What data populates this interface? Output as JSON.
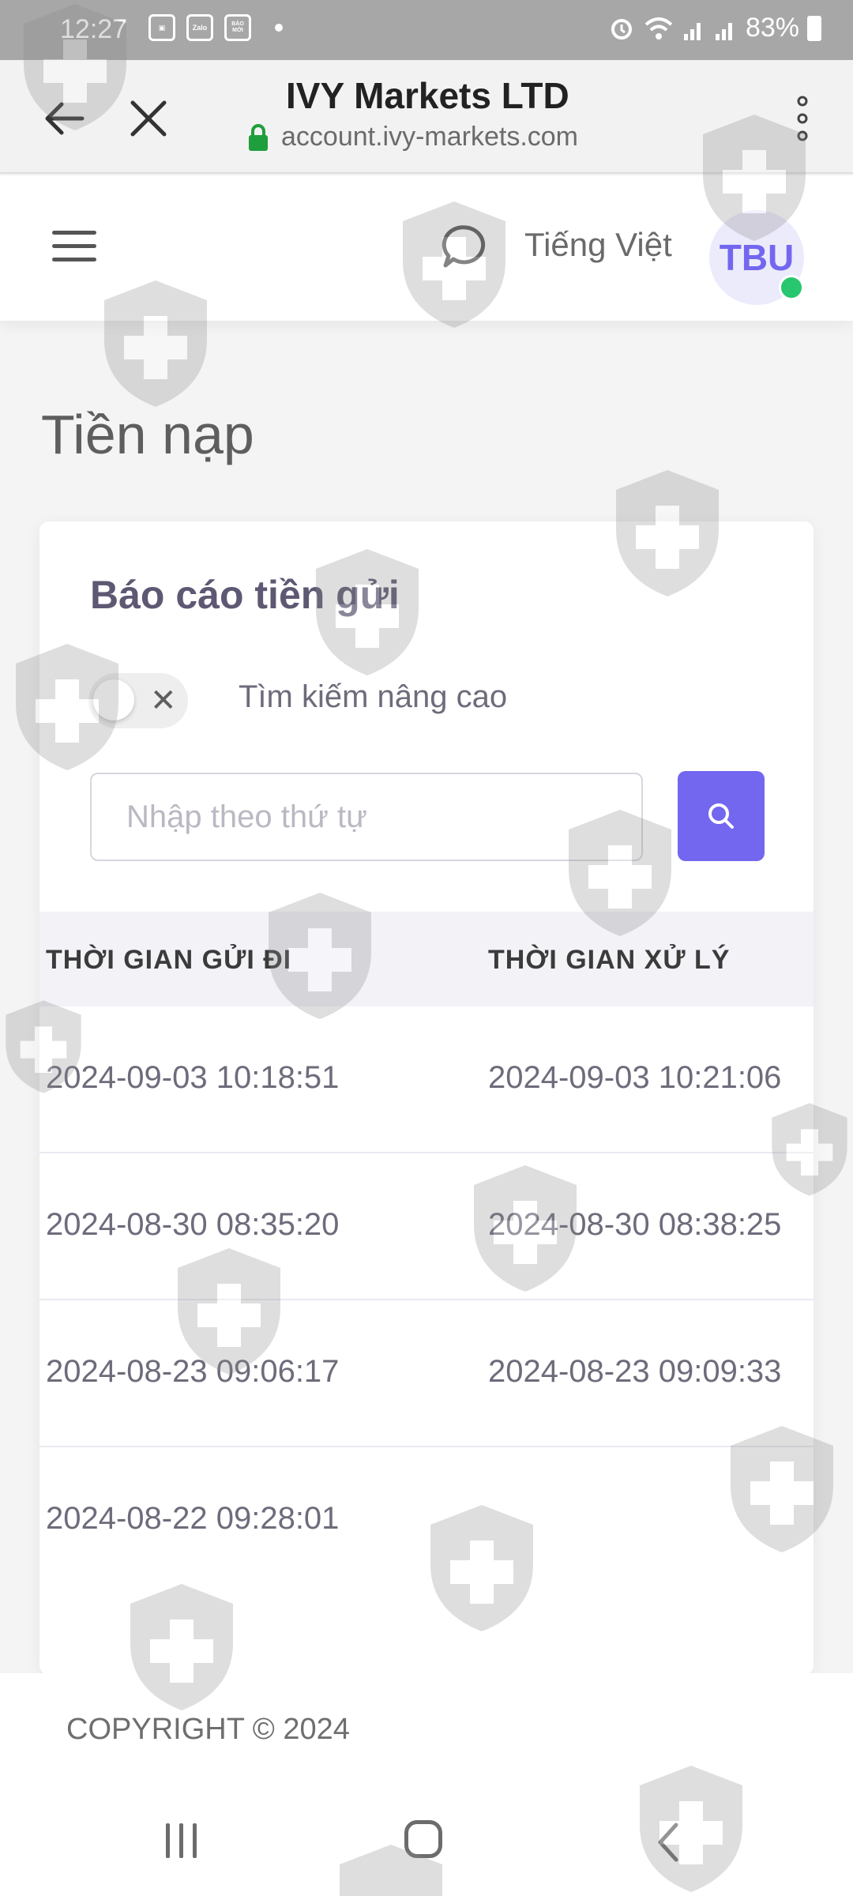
{
  "status_bar": {
    "time": "12:27",
    "notifications": [
      "Zalo",
      "BÁO MỚI"
    ],
    "battery": "83%"
  },
  "browser": {
    "title": "IVY Markets LTD",
    "url": "account.ivy-markets.com"
  },
  "header": {
    "language": "Tiếng Việt",
    "avatar_initials": "TBU"
  },
  "page": {
    "title": "Tiền nạp"
  },
  "card": {
    "title": "Báo cáo tiền gửi",
    "advanced_search_label": "Tìm kiếm nâng cao",
    "search_placeholder": "Nhập theo thứ tự",
    "table": {
      "headers": [
        "THỜI GIAN GỬI ĐI",
        "THỜI GIAN XỬ LÝ"
      ],
      "rows": [
        [
          "2024-09-03 10:18:51",
          "2024-09-03 10:21:06"
        ],
        [
          "2024-08-30 08:35:20",
          "2024-08-30 08:38:25"
        ],
        [
          "2024-08-23 09:06:17",
          "2024-08-23 09:09:33"
        ],
        [
          "2024-08-22 09:28:01",
          ""
        ]
      ]
    }
  },
  "footer": {
    "copyright": "COPYRIGHT © 2024"
  },
  "colors": {
    "accent": "#7367f0",
    "online": "#28c76f",
    "status_bar": "#a7a7a7"
  },
  "icons": [
    "back-arrow-icon",
    "close-icon",
    "lock-icon",
    "more-vert-icon",
    "hamburger-icon",
    "chat-icon",
    "search-icon",
    "toggle-close-icon",
    "nav-recent-icon",
    "nav-home-icon",
    "nav-back-icon",
    "shield-plus-watermark-icon"
  ]
}
